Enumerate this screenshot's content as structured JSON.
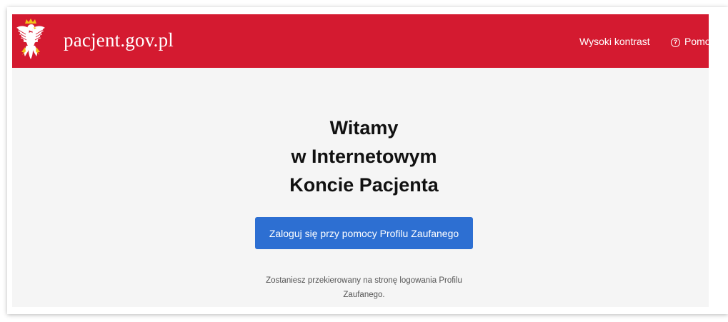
{
  "header": {
    "site_name": "pacjent.gov.pl",
    "background_color": "#d41a30",
    "logo_icon": "polish-eagle-emblem",
    "links": {
      "high_contrast": "Wysoki kontrast",
      "help": "Pomoc",
      "help_icon": "question-circle-icon"
    }
  },
  "main": {
    "welcome_lines": [
      "Witamy",
      "w Internetowym",
      "Koncie Pacjenta"
    ],
    "login_button": "Zaloguj się przy pomocy Profilu Zaufanego",
    "login_button_color": "#2d6fd2",
    "redirect_note": "Zostaniesz przekierowany na stronę logowania Profilu Zaufanego."
  }
}
